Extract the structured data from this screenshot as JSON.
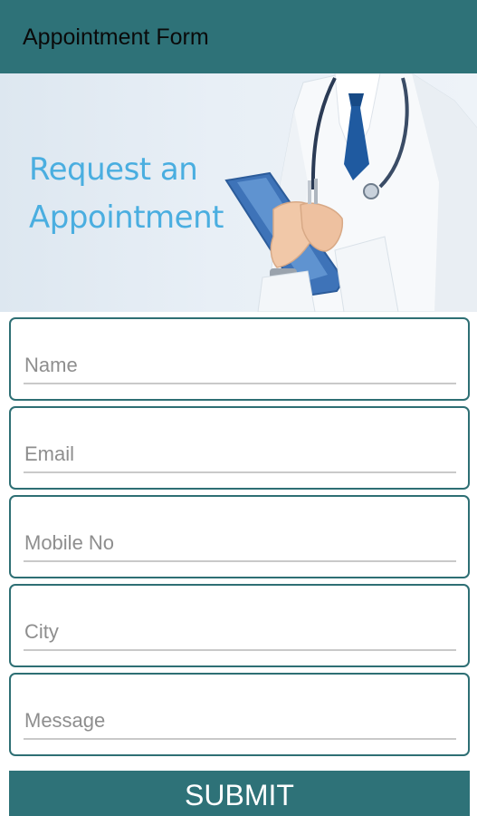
{
  "app_bar": {
    "title": "Appointment Form"
  },
  "banner": {
    "line1": "Request an",
    "line2": "Appointment",
    "image_icon": "doctor-with-clipboard-illustration"
  },
  "form": {
    "fields": [
      {
        "placeholder": "Name",
        "value": ""
      },
      {
        "placeholder": "Email",
        "value": ""
      },
      {
        "placeholder": "Mobile No",
        "value": ""
      },
      {
        "placeholder": "City",
        "value": ""
      },
      {
        "placeholder": "Message",
        "value": ""
      }
    ],
    "submit_label": "SUBMIT"
  },
  "colors": {
    "app_bar": "#2e7278",
    "field_border": "#2e6f74",
    "banner_text": "#4aaee0",
    "submit": "#2e7278"
  }
}
